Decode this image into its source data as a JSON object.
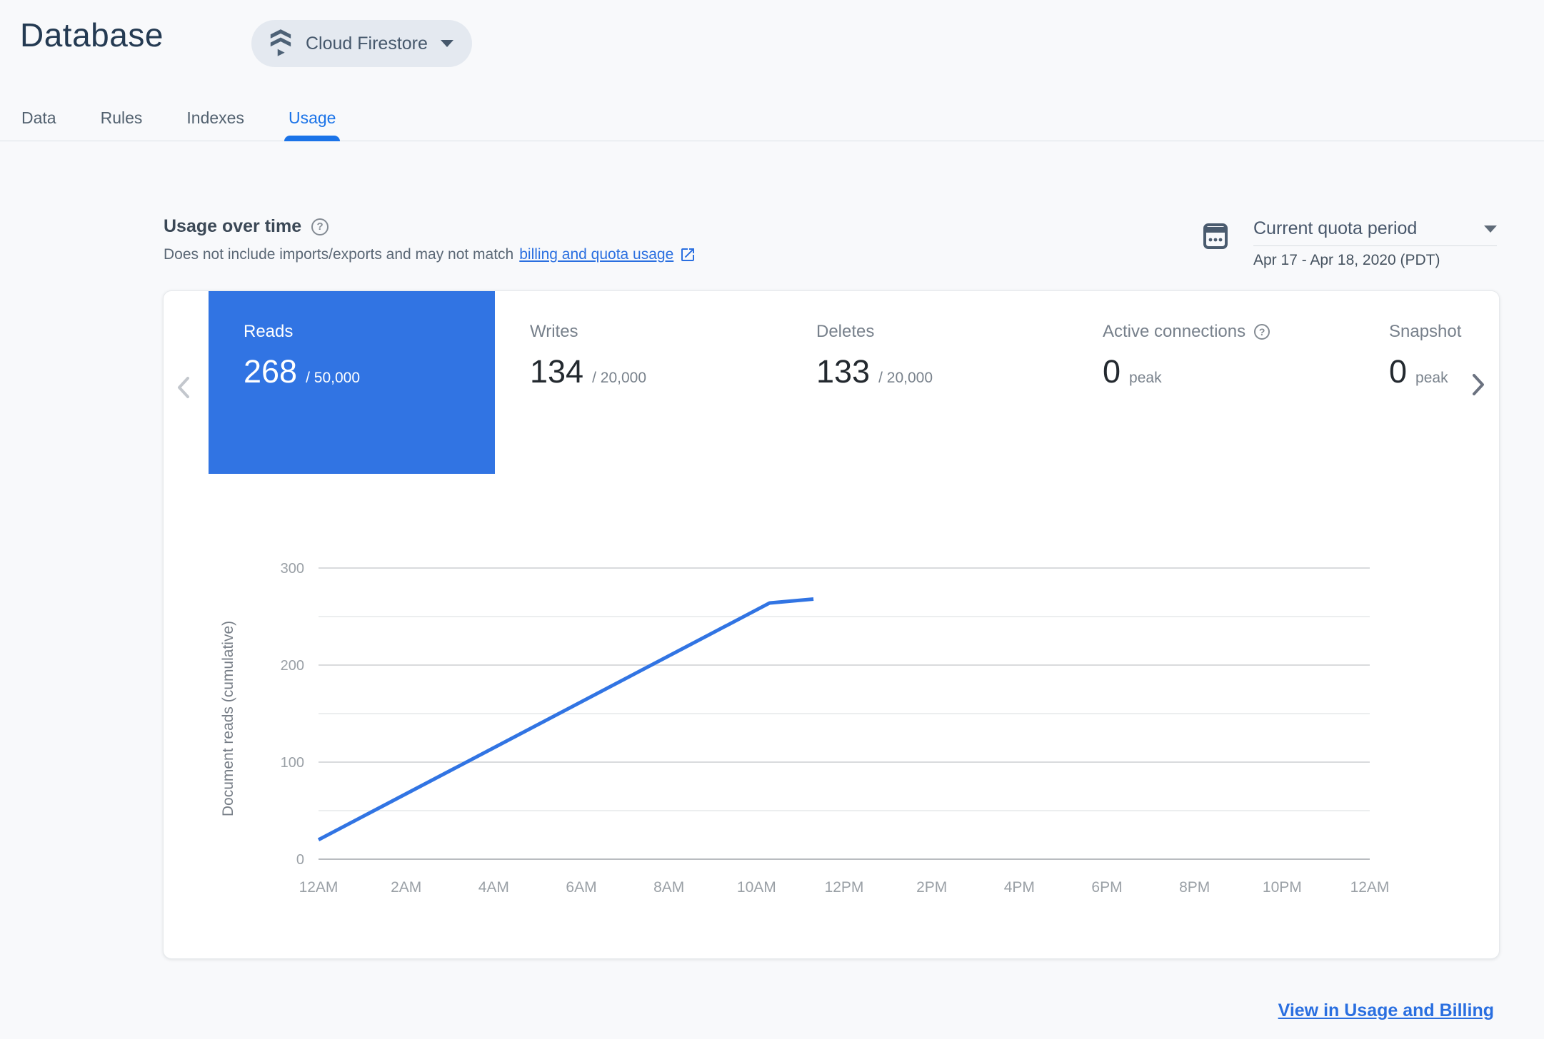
{
  "header": {
    "title": "Database",
    "product_selector": {
      "label": "Cloud Firestore"
    }
  },
  "tabs": [
    {
      "label": "Data",
      "active": false
    },
    {
      "label": "Rules",
      "active": false
    },
    {
      "label": "Indexes",
      "active": false
    },
    {
      "label": "Usage",
      "active": true
    }
  ],
  "usage_section": {
    "title": "Usage over time",
    "description_prefix": "Does not include imports/exports and may not match ",
    "description_link": "billing and quota usage",
    "period_selector": {
      "label": "Current quota period",
      "value": "Apr 17 - Apr 18, 2020 (PDT)"
    }
  },
  "metric_cards": [
    {
      "label": "Reads",
      "value": "268",
      "suffix": "/ 50,000",
      "selected": true,
      "has_help": false
    },
    {
      "label": "Writes",
      "value": "134",
      "suffix": "/ 20,000",
      "selected": false,
      "has_help": false
    },
    {
      "label": "Deletes",
      "value": "133",
      "suffix": "/ 20,000",
      "selected": false,
      "has_help": false
    },
    {
      "label": "Active connections",
      "value": "0",
      "suffix": "peak",
      "selected": false,
      "has_help": true
    },
    {
      "label": "Snapshot listeners",
      "value": "0",
      "suffix": "peak",
      "selected": false,
      "has_help": false
    }
  ],
  "footer": {
    "link_label": "View in Usage and Billing"
  },
  "colors": {
    "accent_blue": "#1a73e8",
    "selected_card_blue": "#3174e3",
    "line_blue": "#3174e3",
    "link_blue": "#2a6fe0"
  },
  "chart_data": {
    "type": "line",
    "title": "",
    "xlabel": "",
    "ylabel": "Document reads (cumulative)",
    "x_tick_labels": [
      "12AM",
      "2AM",
      "4AM",
      "6AM",
      "8AM",
      "10AM",
      "12PM",
      "2PM",
      "4PM",
      "6PM",
      "8PM",
      "10PM",
      "12AM"
    ],
    "x_tick_hours": [
      0,
      2,
      4,
      6,
      8,
      10,
      12,
      14,
      16,
      18,
      20,
      22,
      24
    ],
    "x_range_hours": [
      0,
      24
    ],
    "ylim": [
      0,
      300
    ],
    "y_ticks": [
      0,
      100,
      200,
      300
    ],
    "y_minor_ticks": [
      50,
      150,
      250
    ],
    "grid": true,
    "legend": "none",
    "series": [
      {
        "name": "Reads (cumulative)",
        "points": [
          {
            "hour": 0,
            "value": 20
          },
          {
            "hour": 10.3,
            "value": 264
          },
          {
            "hour": 11.3,
            "value": 268
          }
        ]
      }
    ]
  }
}
